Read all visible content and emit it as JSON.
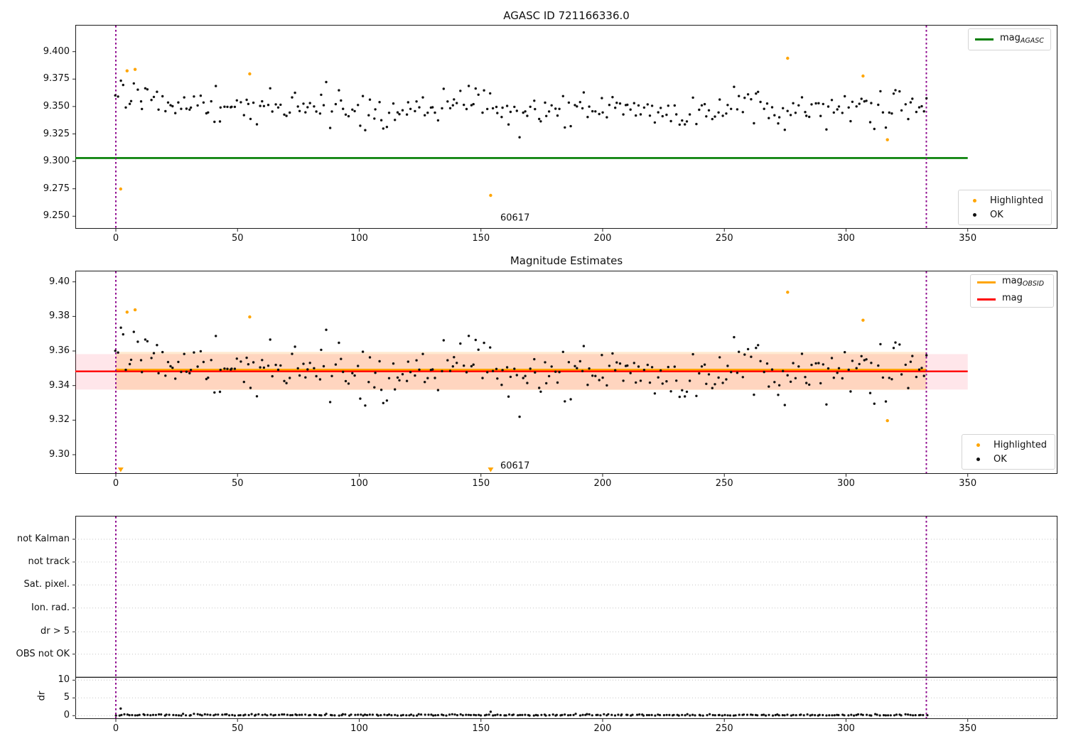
{
  "figure": {
    "background": "#ffffff"
  },
  "colors": {
    "ok_point": "#111111",
    "highlighted_point": "#FFA500",
    "agasc_mag_line": "#007D00",
    "mag_line": "#FF0000",
    "obsid_mag_line": "#FFA500",
    "obsid_boundary_vline": "#8B008B",
    "grid": "#c6c6c6",
    "separator_line": "#222222",
    "mag_band": "rgba(255,60,90,0.13)",
    "obsid_band": "rgba(255,140,0,0.18)"
  },
  "chart_data": [
    {
      "id": "agasc-panel",
      "type": "scatter",
      "title": "AGASC ID 721166336.0",
      "xlim": [
        -16.6,
        386.9
      ],
      "ylim": [
        9.2386,
        9.4244
      ],
      "xticks": [
        0,
        50,
        100,
        150,
        200,
        250,
        300,
        350
      ],
      "xtick_labels": [
        "0",
        "50",
        "100",
        "150",
        "200",
        "250",
        "300",
        "350"
      ],
      "yticks": [
        9.4,
        9.375,
        9.35,
        9.325,
        9.3,
        9.275,
        9.25
      ],
      "ytick_labels": [
        "9.400",
        "9.375",
        "9.350",
        "9.325",
        "9.300",
        "9.275",
        "9.250"
      ],
      "agasc_mag_line": {
        "value": 9.303,
        "x_start": -16.6,
        "x_end": 350
      },
      "obsid_vlines": [
        0,
        333
      ],
      "highlighted_points": [
        [
          2,
          9.2748
        ],
        [
          4.6,
          9.3825
        ],
        [
          7.9,
          9.3838
        ],
        [
          55,
          9.3797
        ],
        [
          154,
          9.269
        ],
        [
          276,
          9.394
        ],
        [
          307,
          9.3778
        ],
        [
          317,
          9.3197
        ]
      ],
      "ok_points_distribution": {
        "count": 300,
        "x_min": 0,
        "x_max": 333,
        "y_mean": 9.3475,
        "y_std": 0.0082,
        "y_clip": [
          9.3215,
          9.3735
        ],
        "early_trend_boost": 0.013,
        "seed": 20230617
      },
      "annotation": {
        "text": "60617",
        "x": 164,
        "y": 9.2483
      },
      "legend_lines": [
        {
          "label_main": "mag",
          "label_sub": "AGASC",
          "color": "#007D00"
        }
      ],
      "legend_markers": [
        {
          "label": "Highlighted",
          "color": "#FFA500"
        },
        {
          "label": "OK",
          "color": "#111111"
        }
      ]
    },
    {
      "id": "magnitude-estimates-panel",
      "type": "scatter",
      "title": "Magnitude Estimates",
      "xlim": [
        -16.6,
        386.9
      ],
      "ylim": [
        9.2889,
        9.4065
      ],
      "xticks": [
        0,
        50,
        100,
        150,
        200,
        250,
        300,
        350
      ],
      "xtick_labels": [
        "0",
        "50",
        "100",
        "150",
        "200",
        "250",
        "300",
        "350"
      ],
      "yticks": [
        9.4,
        9.38,
        9.36,
        9.34,
        9.32,
        9.3
      ],
      "ytick_labels": [
        "9.40",
        "9.38",
        "9.36",
        "9.34",
        "9.32",
        "9.30"
      ],
      "mag_line": {
        "value": 9.3482,
        "x_start": -16.6,
        "x_end": 350
      },
      "mag_band": {
        "y_low": 9.3377,
        "y_high": 9.3582,
        "x_start": -16.6,
        "x_end": 350
      },
      "obsid_mag_line": {
        "value": 9.3487,
        "x_start": 0,
        "x_end": 333
      },
      "obsid_band": {
        "y_low": 9.3375,
        "y_high": 9.3595,
        "x_start": 0,
        "x_end": 333
      },
      "obsid_vlines": [
        0,
        333
      ],
      "highlighted_points": [
        [
          4.6,
          9.3825
        ],
        [
          7.9,
          9.3838
        ],
        [
          55,
          9.3797
        ],
        [
          276,
          9.394
        ],
        [
          307,
          9.3778
        ],
        [
          317,
          9.3197
        ]
      ],
      "below_range_marker_xs": [
        2,
        154
      ],
      "annotation": {
        "text": "60617",
        "x": 164,
        "y": 9.2935
      },
      "legend_lines": [
        {
          "label_main": "mag",
          "label_sub": "OBSID",
          "color": "#FFA500"
        },
        {
          "label_main": "mag",
          "label_sub": "",
          "color": "#FF0000"
        }
      ],
      "legend_markers": [
        {
          "label": "Highlighted",
          "color": "#FFA500"
        },
        {
          "label": "OK",
          "color": "#111111"
        }
      ]
    },
    {
      "id": "flags-panel",
      "type": "scatter",
      "categories": [
        "not Kalman",
        "not track",
        "Sat. pixel.",
        "Ion. rad.",
        "dr > 5",
        "OBS not OK"
      ],
      "dr_ticks": [
        10,
        5,
        0
      ],
      "dr_tick_labels": [
        "10",
        "5",
        "0"
      ],
      "dr_axis_label": "dr",
      "dr_limit_line": 10.8,
      "obsid_vlines": [
        0,
        333
      ],
      "xticks": [
        0,
        50,
        100,
        150,
        200,
        250,
        300,
        350
      ],
      "xtick_labels": [
        "0",
        "50",
        "100",
        "150",
        "200",
        "250",
        "300",
        "350"
      ],
      "dr_points_distribution": {
        "count": 300,
        "x_min": 0,
        "x_max": 333,
        "mean": 0.18,
        "std": 0.11,
        "clip": [
          0.04,
          0.65
        ],
        "seed": 60617
      },
      "dr_outliers": [
        [
          2,
          2.0
        ],
        [
          154,
          1.1
        ]
      ]
    }
  ]
}
